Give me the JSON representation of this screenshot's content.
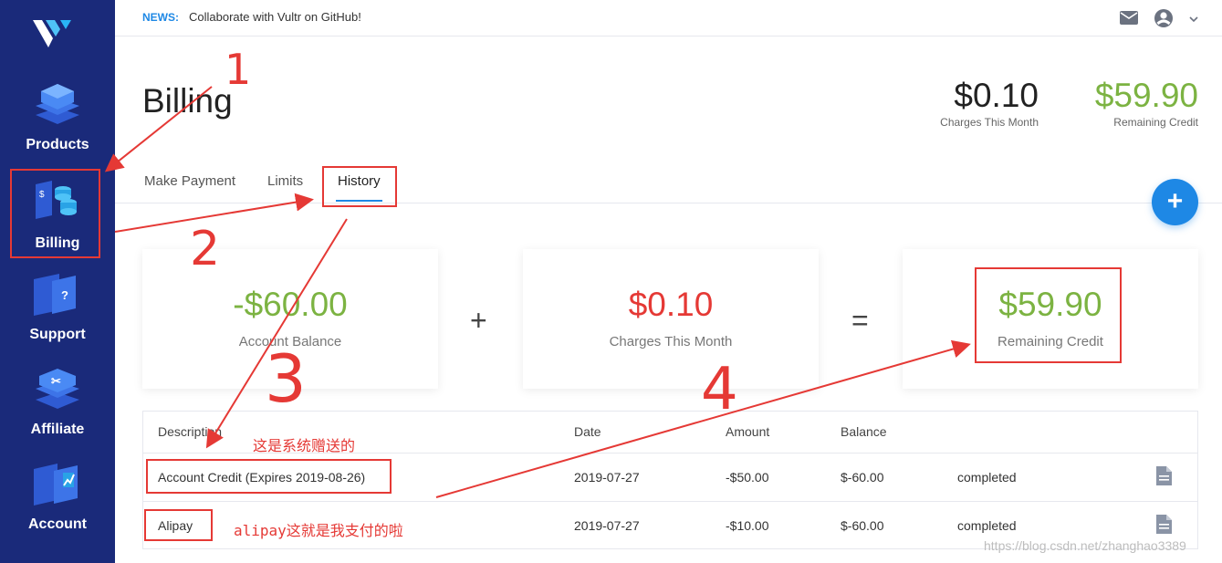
{
  "colors": {
    "sidebar": "#1a2a7a",
    "accent": "#1e88e5",
    "positive": "#7cb342",
    "negative": "#e53935",
    "annotation": "#e53935"
  },
  "sidebar": {
    "items": [
      {
        "label": "Products",
        "icon": "products-stack-icon"
      },
      {
        "label": "Billing",
        "icon": "billing-coins-icon"
      },
      {
        "label": "Support",
        "icon": "support-question-icon"
      },
      {
        "label": "Affiliate",
        "icon": "affiliate-scissors-icon"
      },
      {
        "label": "Account",
        "icon": "account-chart-icon"
      }
    ]
  },
  "topbar": {
    "news_label": "NEWS:",
    "news_text": "Collaborate with Vultr on GitHub!"
  },
  "header": {
    "title": "Billing",
    "charges_value": "$0.10",
    "charges_label": "Charges This Month",
    "credit_value": "$59.90",
    "credit_label": "Remaining Credit"
  },
  "tabs": [
    {
      "label": "Make Payment"
    },
    {
      "label": "Limits"
    },
    {
      "label": "History"
    }
  ],
  "fab": {
    "label": "+"
  },
  "cards": {
    "balance": {
      "value": "-$60.00",
      "label": "Account Balance"
    },
    "charges": {
      "value": "$0.10",
      "label": "Charges This Month"
    },
    "credit": {
      "value": "$59.90",
      "label": "Remaining Credit"
    },
    "plus": "+",
    "equals": "="
  },
  "table": {
    "headers": [
      "Description",
      "Date",
      "Amount",
      "Balance"
    ],
    "rows": [
      {
        "description": "Account Credit (Expires 2019-08-26)",
        "date": "2019-07-27",
        "amount": "-$50.00",
        "balance": "$-60.00",
        "status": "completed"
      },
      {
        "description": "Alipay",
        "date": "2019-07-27",
        "amount": "-$10.00",
        "balance": "$-60.00",
        "status": "completed"
      }
    ]
  },
  "annotations": {
    "n1": "1",
    "n2": "2",
    "n3": "3",
    "n4": "4",
    "note_row1": "这是系统赠送的",
    "note_row2": "alipay这就是我支付的啦"
  },
  "watermark": "https://blog.csdn.net/zhanghao3389"
}
